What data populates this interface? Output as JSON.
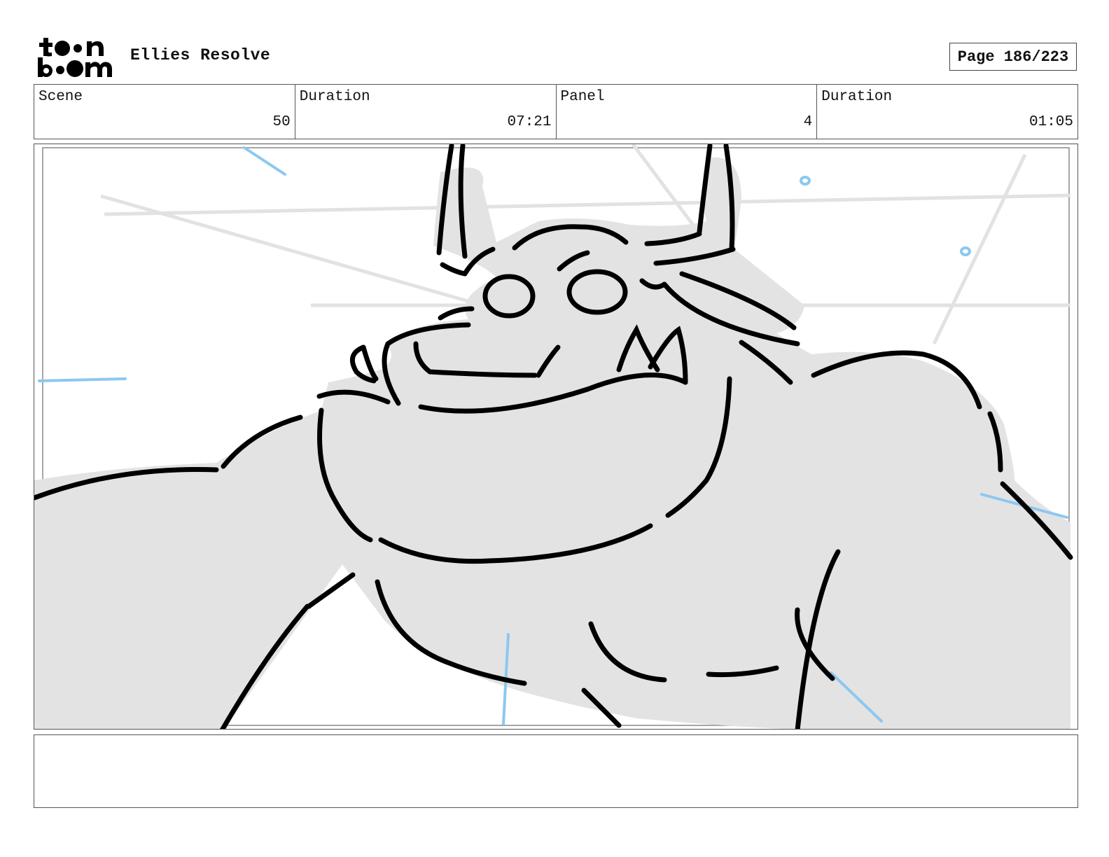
{
  "header": {
    "logo_text": "toon boom",
    "project_title": "Ellies Resolve",
    "page_label": "Page",
    "page_value": "186/223"
  },
  "info": {
    "scene_label": "Scene",
    "scene_value": "50",
    "scene_duration_label": "Duration",
    "scene_duration_value": "07:21",
    "panel_label": "Panel",
    "panel_value": "4",
    "panel_duration_label": "Duration",
    "panel_duration_value": "01:05"
  },
  "notes": {
    "text": ""
  },
  "colors": {
    "ink": "#000000",
    "fill": "#e3e3e3",
    "guide_lines": "#e6e6e6",
    "motion_lines": "#8cc8f0"
  }
}
